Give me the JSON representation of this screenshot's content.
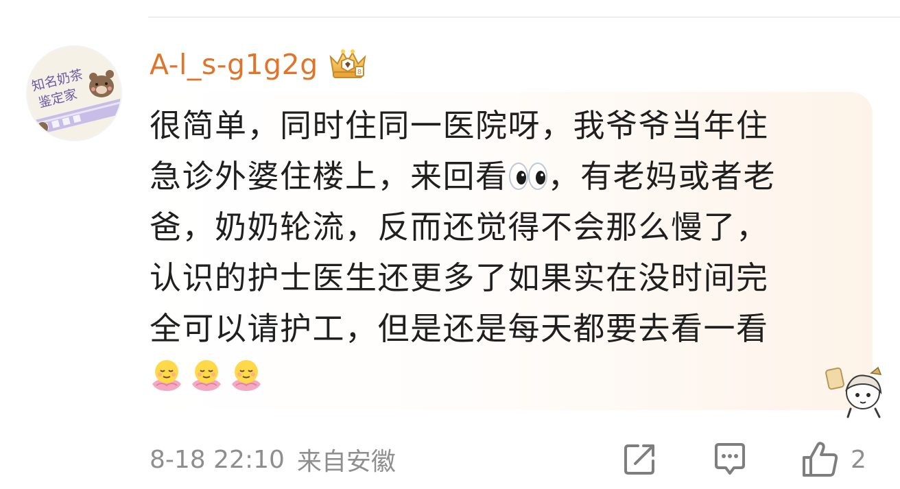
{
  "comment": {
    "username": "A-l_s-g1g2g",
    "avatar_text_line1": "知名奶茶",
    "avatar_text_line2": "鉴定家",
    "avatar_label": "Bear",
    "lines": [
      "很简单，同时住同一医院呀，我爷爷当年住",
      "急诊外婆住楼上，来回看",
      "，有老妈或者老",
      "爸，奶奶轮流，反而还觉得不会那么慢了，",
      "认识的护士医生还更多了如果实在没时间完",
      "全可以请护工，但是还是每天都要去看一看"
    ],
    "inline_emoji": "eyes-emoji",
    "trailing_emojis": [
      "blessing-emoji",
      "blessing-emoji",
      "blessing-emoji"
    ],
    "timestamp": "8-18 22:10",
    "location": "来自安徽",
    "like_count": "2"
  },
  "icons": {
    "crown": "crown-badge-icon",
    "share": "share-icon",
    "reply": "reply-icon",
    "like": "thumbs-up-icon"
  },
  "colors": {
    "username": "#e0742a",
    "text": "#1f1f1f",
    "meta": "#8e8e8e",
    "bubble_tint": "#fdf3e9"
  }
}
